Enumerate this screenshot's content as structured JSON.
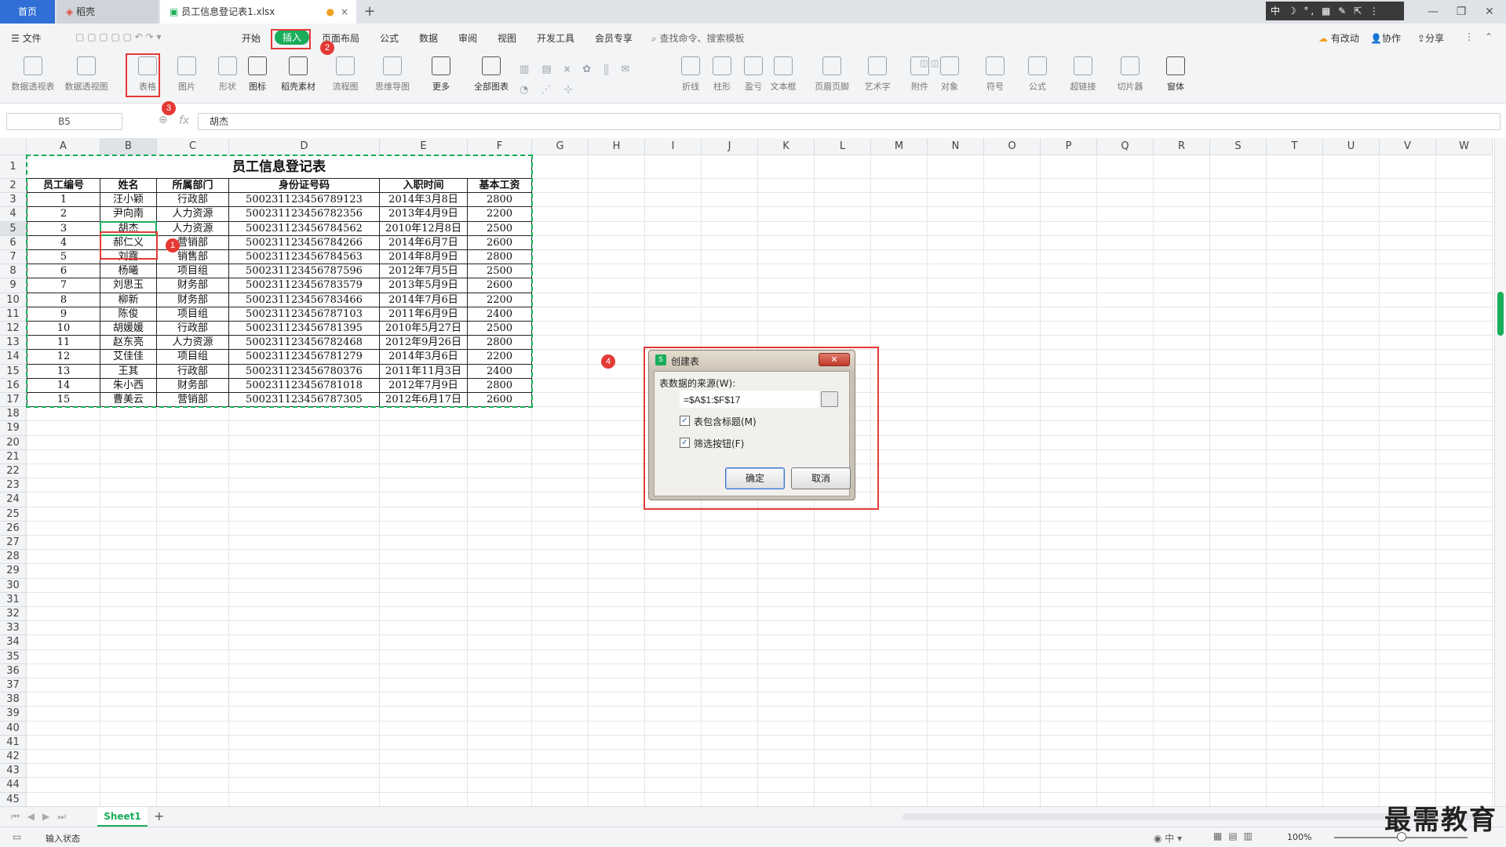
{
  "tabs": {
    "home": "首页",
    "docer": "稻壳",
    "document": "员工信息登记表1.xlsx",
    "close_glyph": "×",
    "add_glyph": "+"
  },
  "ime": "中 ☽ °, ▦ ✎ ⇱ ⋮",
  "menu": {
    "file": "☰ 文件",
    "items": [
      "开始",
      "插入",
      "页面布局",
      "公式",
      "数据",
      "审阅",
      "视图",
      "开发工具",
      "会员专享"
    ],
    "search": "查找命令、搜索模板",
    "unsync": "有改动",
    "collab": "协作",
    "share": "分享"
  },
  "ribbon": [
    {
      "label": "数据透视表",
      "icon": "pivot-table-icon",
      "dark": false
    },
    {
      "label": "数据透视图",
      "icon": "pivot-chart-icon",
      "dark": false
    },
    {
      "label": "表格",
      "icon": "table-icon",
      "dark": false
    },
    {
      "label": "图片",
      "icon": "picture-icon",
      "dark": false
    },
    {
      "label": "形状",
      "icon": "shape-icon",
      "dark": false
    },
    {
      "label": "图标",
      "icon": "icons-icon",
      "dark": true
    },
    {
      "label": "稻壳素材",
      "icon": "docer-material-icon",
      "dark": true
    },
    {
      "label": "流程图",
      "icon": "flowchart-icon",
      "dark": false
    },
    {
      "label": "思维导图",
      "icon": "mindmap-icon",
      "dark": false
    },
    {
      "label": "更多",
      "icon": "more-icon",
      "dark": true
    },
    {
      "label": "全部图表",
      "icon": "all-charts-icon",
      "dark": true
    },
    {
      "label": "折线",
      "icon": "line-spark-icon",
      "dark": false
    },
    {
      "label": "柱形",
      "icon": "column-spark-icon",
      "dark": false
    },
    {
      "label": "盈亏",
      "icon": "winloss-spark-icon",
      "dark": false
    },
    {
      "label": "文本框",
      "icon": "textbox-icon",
      "dark": false
    },
    {
      "label": "页眉页脚",
      "icon": "header-footer-icon",
      "dark": false
    },
    {
      "label": "艺术字",
      "icon": "wordart-icon",
      "dark": false
    },
    {
      "label": "附件",
      "icon": "attachment-icon",
      "dark": false
    },
    {
      "label": "对象",
      "icon": "object-icon",
      "dark": false
    },
    {
      "label": "符号",
      "icon": "symbol-icon",
      "dark": false
    },
    {
      "label": "公式",
      "icon": "equation-icon",
      "dark": false
    },
    {
      "label": "超链接",
      "icon": "hyperlink-icon",
      "dark": false
    },
    {
      "label": "切片器",
      "icon": "slicer-icon",
      "dark": false
    },
    {
      "label": "窗体",
      "icon": "form-icon",
      "dark": true
    }
  ],
  "formula_bar": {
    "name_box": "B5",
    "fx": "fx",
    "value": "胡杰"
  },
  "columns": [
    "A",
    "B",
    "C",
    "D",
    "E",
    "F",
    "G",
    "H",
    "I",
    "J",
    "K",
    "L",
    "M",
    "N",
    "O",
    "P",
    "Q",
    "R",
    "S",
    "T",
    "U",
    "V",
    "W"
  ],
  "table": {
    "title": "员工信息登记表",
    "headers": [
      "员工编号",
      "姓名",
      "所属部门",
      "身份证号码",
      "入职时间",
      "基本工资"
    ],
    "rows": [
      [
        "1",
        "汪小颖",
        "行政部",
        "500231123456789123",
        "2014年3月8日",
        "2800"
      ],
      [
        "2",
        "尹向南",
        "人力资源",
        "500231123456782356",
        "2013年4月9日",
        "2200"
      ],
      [
        "3",
        "胡杰",
        "人力资源",
        "500231123456784562",
        "2010年12月8日",
        "2500"
      ],
      [
        "4",
        "郝仁义",
        "营销部",
        "500231123456784266",
        "2014年6月7日",
        "2600"
      ],
      [
        "5",
        "刘露",
        "销售部",
        "500231123456784563",
        "2014年8月9日",
        "2800"
      ],
      [
        "6",
        "杨曦",
        "项目组",
        "500231123456787596",
        "2012年7月5日",
        "2500"
      ],
      [
        "7",
        "刘思玉",
        "财务部",
        "500231123456783579",
        "2013年5月9日",
        "2600"
      ],
      [
        "8",
        "柳新",
        "财务部",
        "500231123456783466",
        "2014年7月6日",
        "2200"
      ],
      [
        "9",
        "陈俊",
        "项目组",
        "500231123456787103",
        "2011年6月9日",
        "2400"
      ],
      [
        "10",
        "胡媛媛",
        "行政部",
        "500231123456781395",
        "2010年5月27日",
        "2500"
      ],
      [
        "11",
        "赵东亮",
        "人力资源",
        "500231123456782468",
        "2012年9月26日",
        "2800"
      ],
      [
        "12",
        "艾佳佳",
        "项目组",
        "500231123456781279",
        "2014年3月6日",
        "2200"
      ],
      [
        "13",
        "王其",
        "行政部",
        "500231123456780376",
        "2011年11月3日",
        "2400"
      ],
      [
        "14",
        "朱小西",
        "财务部",
        "500231123456781018",
        "2012年7月9日",
        "2800"
      ],
      [
        "15",
        "曹美云",
        "营销部",
        "500231123456787305",
        "2012年6月17日",
        "2600"
      ]
    ]
  },
  "badges": [
    "1",
    "2",
    "3",
    "4"
  ],
  "dialog": {
    "title": "创建表",
    "source_label": "表数据的来源(W):",
    "source_value": "=$A$1:$F$17",
    "has_headers": "表包含标题(M)",
    "filter_button": "筛选按钮(F)",
    "ok": "确定",
    "cancel": "取消",
    "check_glyph": "✓"
  },
  "sheet": {
    "name": "Sheet1",
    "add": "+"
  },
  "status": {
    "mode": "输入状态",
    "zoom": "100%"
  },
  "watermark": "最需教育",
  "colors": {
    "accent": "#1aad5a",
    "annotation": "#e53935",
    "tab_home": "#2f6fd6"
  }
}
